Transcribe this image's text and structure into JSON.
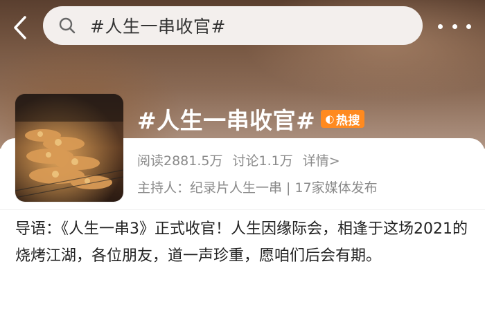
{
  "search": {
    "query": "#人生一串收官#"
  },
  "topic": {
    "title": "#人生一串收官#",
    "badge": "热搜",
    "reads": "阅读2881.5万",
    "discussions": "讨论1.1万",
    "details": "详情>",
    "host_line": "主持人：纪录片人生一串 | 17家媒体发布"
  },
  "intro": {
    "text": "导语：《人生一串3》正式收官！人生因缘际会，相逢于这场2021的烧烤江湖，各位朋友，道一声珍重，愿咱们后会有期。"
  },
  "icons": [
    "chevron-left-icon",
    "search-icon",
    "more-icon",
    "hot-search-icon"
  ],
  "colors": {
    "badge": "#ff8a1f",
    "header_bg": "#6b4c3a",
    "text_secondary": "#8a8a8a"
  }
}
